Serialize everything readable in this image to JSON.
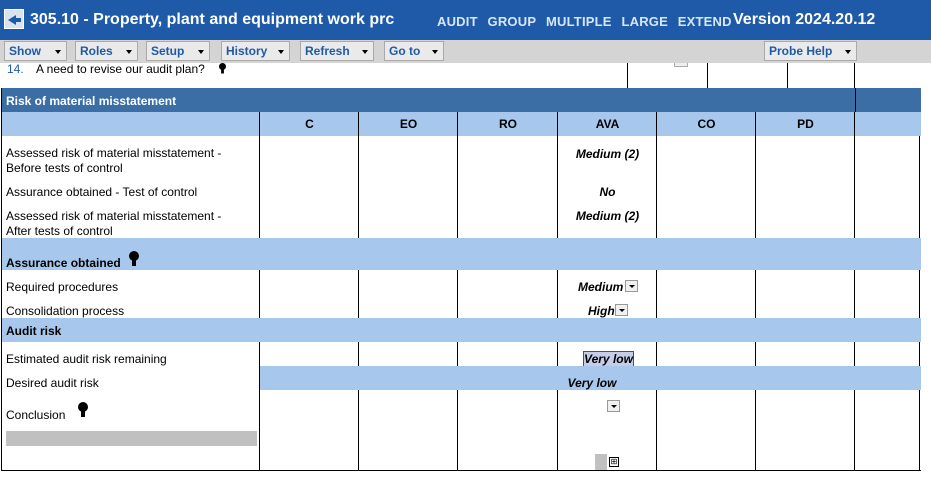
{
  "window": {
    "title": "305.10 - Property, plant and equipment work prc",
    "tags": [
      "AUDIT",
      "GROUP",
      "MULTIPLE",
      "LARGE",
      "EXTEND"
    ],
    "version": "Version 2024.20.12"
  },
  "menu": {
    "show": "Show",
    "roles": "Roles",
    "setup": "Setup",
    "history": "History",
    "refresh": "Refresh",
    "goto": "Go to",
    "probe_help": "Probe Help"
  },
  "question": {
    "number": "14.",
    "text": "A need to revise our audit plan?"
  },
  "risk_section": {
    "title": "Risk of material misstatement",
    "columns": [
      "C",
      "EO",
      "RO",
      "AVA",
      "CO",
      "PD"
    ],
    "rows": [
      {
        "label_line1": "Assessed risk of material misstatement -",
        "label_line2": "Before tests of control",
        "ava": "Medium (2)"
      },
      {
        "label_line1": "Assurance obtained - Test of control",
        "label_line2": "",
        "ava": "No"
      },
      {
        "label_line1": "Assessed risk of material misstatement -",
        "label_line2": "After tests of control",
        "ava": "Medium (2)"
      }
    ]
  },
  "assurance_section": {
    "title": "Assurance obtained",
    "required_procedures_label": "Required procedures",
    "required_procedures_value": "Medium",
    "consolidation_label": "Consolidation process",
    "consolidation_value": "High"
  },
  "audit_risk_section": {
    "title": "Audit risk",
    "estimated_label": "Estimated audit risk remaining",
    "estimated_value": "Very low",
    "desired_label": "Desired audit risk",
    "desired_value": "Very low",
    "conclusion_label": "Conclusion"
  },
  "colors": {
    "title_bar": "#1e5aa8",
    "section_dark": "#3a6ea5",
    "section_light": "#a7c8ec",
    "highlight": "#c6cde8"
  }
}
